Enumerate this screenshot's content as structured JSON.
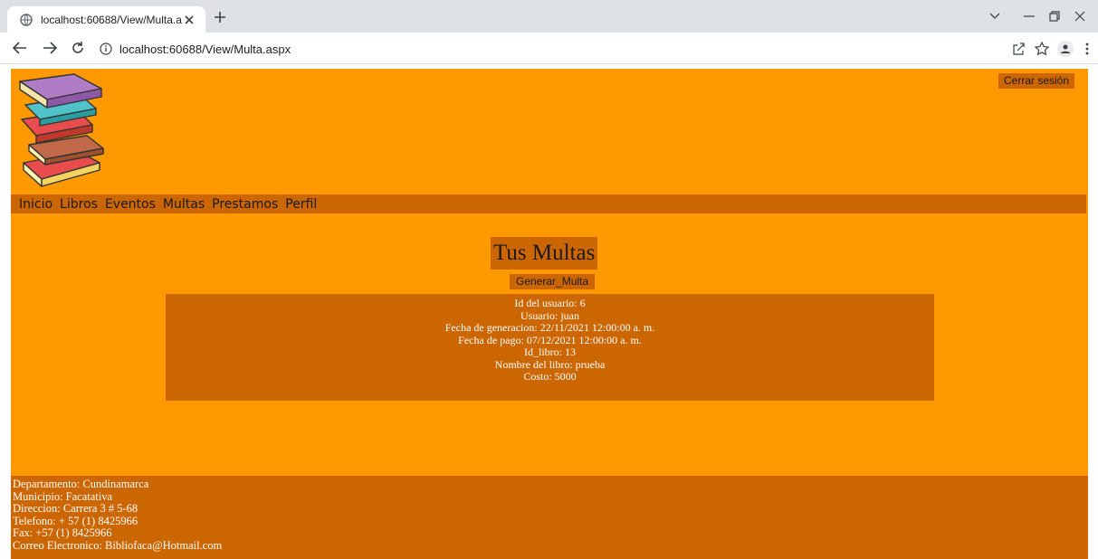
{
  "browser": {
    "tab_title": "localhost:60688/View/Multa.aspx",
    "url": "localhost:60688/View/Multa.aspx",
    "icons": [
      "globe-icon",
      "close-icon",
      "plus-icon",
      "chevron-down-icon",
      "minimize-icon",
      "restore-icon",
      "close-window-icon",
      "back-icon",
      "forward-icon",
      "reload-icon",
      "info-icon",
      "share-icon",
      "star-icon",
      "profile-icon",
      "kebab-menu-icon"
    ]
  },
  "header": {
    "logout_label": "Cerrar sesión"
  },
  "menu": {
    "items": [
      {
        "label": "Inicio"
      },
      {
        "label": "Libros"
      },
      {
        "label": "Eventos"
      },
      {
        "label": "Multas"
      },
      {
        "label": "Prestamos"
      },
      {
        "label": "Perfil"
      }
    ]
  },
  "main": {
    "title": "Tus Multas",
    "generate_label": "Generar_Multa",
    "fine": {
      "user_id": "Id del usuario: 6",
      "user": "Usuario: juan",
      "generated": "Fecha de generacion: 22/11/2021 12:00:00 a. m.",
      "paid": "Fecha de pago: 07/12/2021 12:00:00 a. m.",
      "book_id": "Id_libro: 13",
      "book_name": "Nombre del libro: prueba",
      "cost": "Costo: 5000"
    }
  },
  "footer": {
    "lines": [
      "Departamento: Cundinamarca",
      "Municipio: Facatativa",
      "Direccion: Carrera 3 # 5-68",
      "Telefono: + 57 (1) 8425966",
      "Fax: +57 (1) 8425966",
      "Correo Electronico: Bibliofaca@Hotmail.com"
    ]
  },
  "colors": {
    "page_bg": "#ff9900",
    "accent": "#cc6600"
  }
}
